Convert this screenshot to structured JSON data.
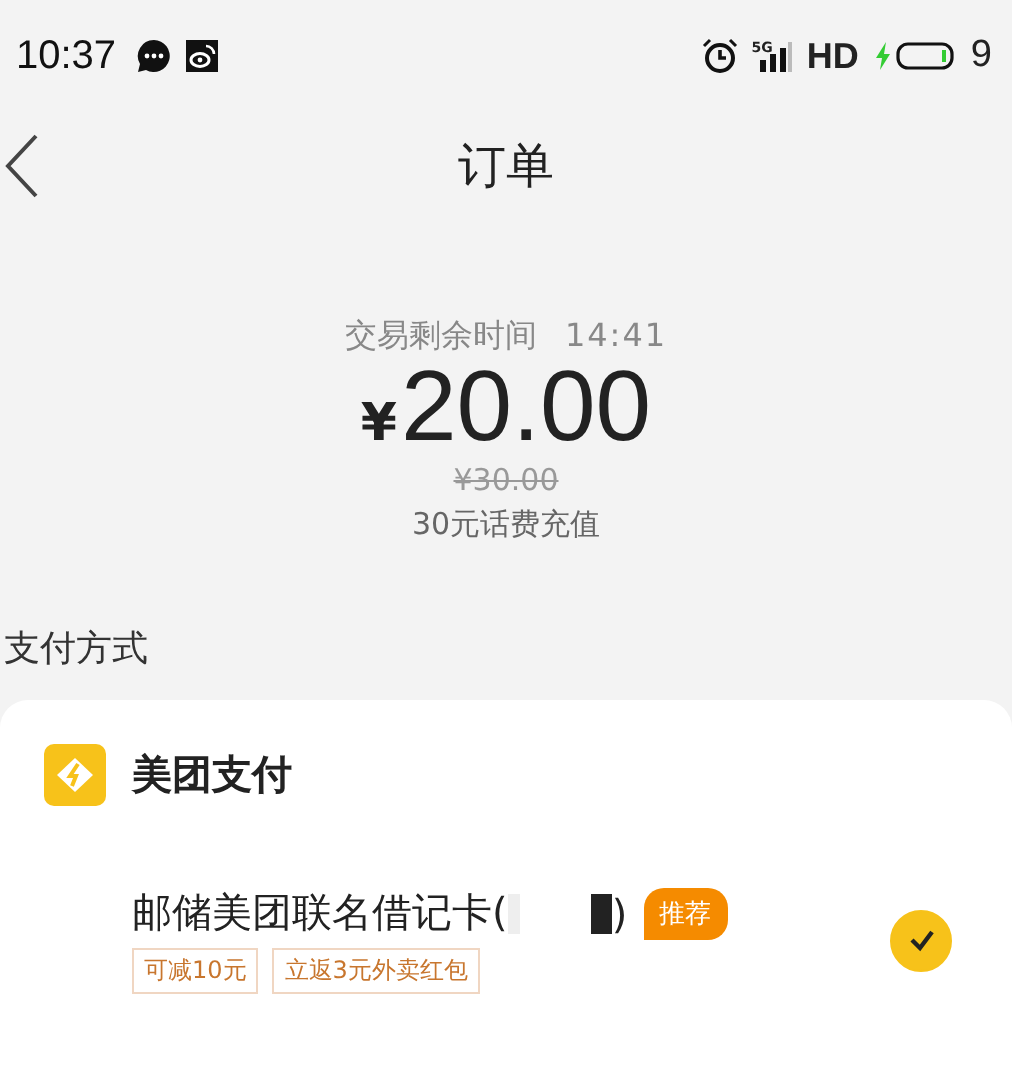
{
  "status_bar": {
    "time": "10:37",
    "network": "5G",
    "hd": "HD",
    "battery": "9"
  },
  "nav": {
    "title": "订单"
  },
  "order": {
    "timer_label": "交易剩余时间",
    "timer": "14:41",
    "currency": "¥",
    "amount": "20.00",
    "original_price": "¥30.00",
    "description": "30元话费充值"
  },
  "payment": {
    "section_title": "支付方式",
    "provider": "美团支付",
    "options": [
      {
        "name": "邮储美团联名借记卡(",
        "name_end": ")",
        "badge": "推荐",
        "selected": true,
        "tags": [
          "可减10元",
          "立返3元外卖红包"
        ]
      }
    ]
  }
}
